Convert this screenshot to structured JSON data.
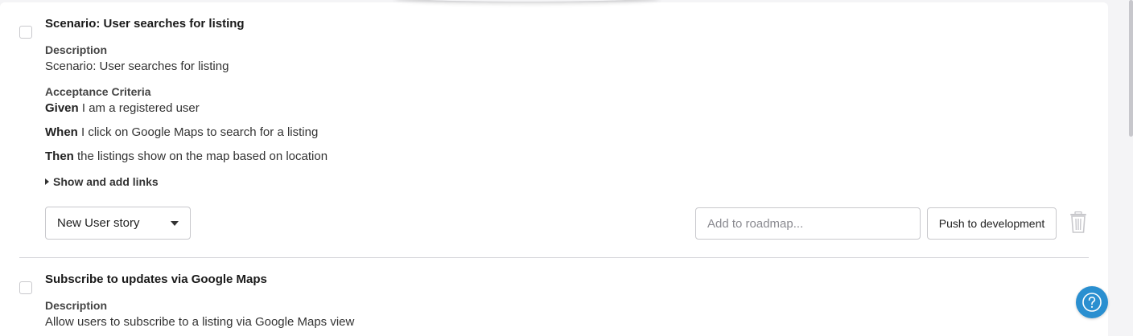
{
  "stories": [
    {
      "title": "Scenario: User searches for listing",
      "description_label": "Description",
      "description": "Scenario: User searches for listing",
      "acceptance_label": "Acceptance Criteria",
      "criteria": [
        {
          "keyword": "Given",
          "text": " I am a registered user"
        },
        {
          "keyword": "When",
          "text": " I click on Google Maps to search for a listing"
        },
        {
          "keyword": "Then",
          "text": " the listings show on the map based on location"
        }
      ],
      "links_toggle": "Show and add links",
      "status_value": "New User story",
      "roadmap_placeholder": "Add to roadmap...",
      "push_label": "Push to development"
    },
    {
      "title": "Subscribe to updates via Google Maps",
      "description_label": "Description",
      "description": "Allow users to subscribe to a listing via Google Maps view"
    }
  ],
  "icons": {
    "trash": "trash-icon",
    "help": "help-icon",
    "caret": "caret-right-icon",
    "dropdown": "chevron-down-icon"
  },
  "colors": {
    "help_button": "#2a8fd0",
    "trash": "#c8c8cc",
    "border": "#c8c8cc"
  }
}
